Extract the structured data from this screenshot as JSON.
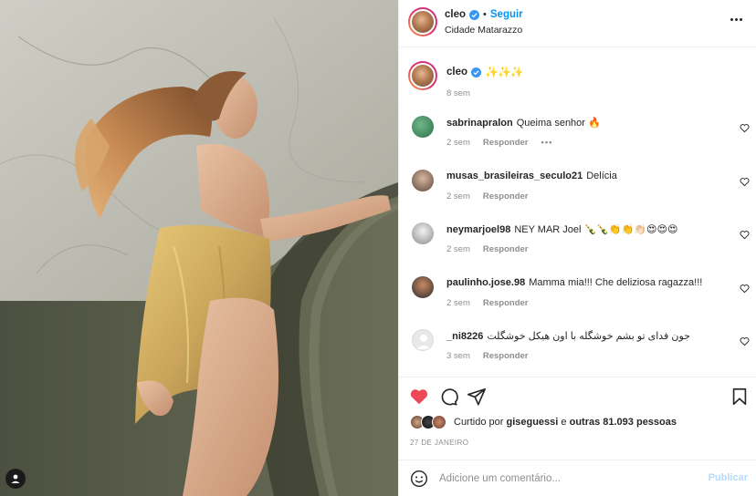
{
  "post_author": {
    "username": "cleo",
    "follow_label": "Seguir",
    "separator": "•",
    "location": "Cidade Matarazzo"
  },
  "caption": {
    "username": "cleo",
    "text": "✨✨✨",
    "time": "8 sem"
  },
  "comments": [
    {
      "username": "sabrinapralon",
      "text": "Queima senhor 🔥",
      "time": "2 sem",
      "reply_label": "Responder",
      "more": "•••"
    },
    {
      "username": "musas_brasileiras_seculo21",
      "text": "Delícia",
      "time": "2 sem",
      "reply_label": "Responder"
    },
    {
      "username": "neymarjoel98",
      "text": "NEY MAR Joel 🍾🍾👏👏👏🏻😍😍😍",
      "time": "2 sem",
      "reply_label": "Responder"
    },
    {
      "username": "paulinho.jose.98",
      "text": "Mamma mia!!! Che deliziosa ragazza!!!",
      "time": "2 sem",
      "reply_label": "Responder"
    },
    {
      "username": "_ni8226",
      "text": "جون فدای تو بشم خوشگله با اون هیکل خوشگلت",
      "time": "3 sem",
      "reply_label": "Responder"
    }
  ],
  "likes": {
    "prefix": "Curtido por",
    "user": "giseguessi",
    "middle": "e",
    "others": "outras 81.093 pessoas"
  },
  "post_date": "27 DE JANEIRO",
  "add_comment": {
    "placeholder": "Adicione um comentário...",
    "publish_label": "Publicar"
  },
  "colors": {
    "accent": "#0095f6",
    "like_red": "#ed4956",
    "publish_disabled": "#b3dbff",
    "muted_text": "#8e8e8e",
    "verified_badge": "#3897f0"
  },
  "icons": [
    "more-options-icon",
    "verified-badge-icon",
    "heart-icon",
    "comment-icon",
    "share-icon",
    "bookmark-icon",
    "emoji-icon",
    "user-tag-icon"
  ]
}
